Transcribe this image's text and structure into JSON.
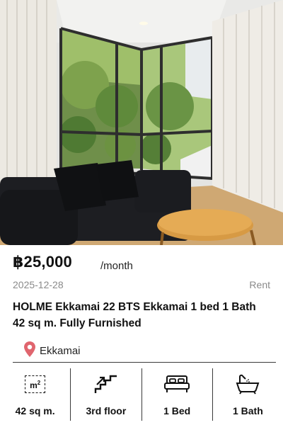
{
  "listing": {
    "price": "฿25,000",
    "period": "/month",
    "date": "2025-12-28",
    "type": "Rent",
    "title": "HOLME Ekkamai 22 BTS Ekkamai 1 bed 1 Bath  42 sq m. Fully Furnished",
    "location": "Ekkamai",
    "location_icon": "map-pin-icon",
    "accent_color": "#e0656e"
  },
  "features": {
    "area": {
      "value": "42 sq m.",
      "icon_text": "m²",
      "icon": "area-icon"
    },
    "floor": {
      "value": "3rd floor",
      "icon": "stairs-icon"
    },
    "bed": {
      "value": "1 Bed",
      "icon": "bed-icon"
    },
    "bath": {
      "value": "1 Bath",
      "icon": "bathtub-icon"
    }
  }
}
